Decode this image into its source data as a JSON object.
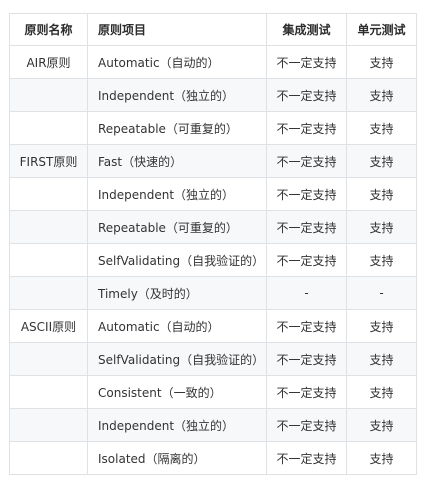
{
  "table": {
    "headers": {
      "principle": "原则名称",
      "item": "原则项目",
      "integration": "集成测试",
      "unit": "单元测试"
    },
    "rows": [
      {
        "principle": "AIR原则",
        "item": "Automatic（自动的）",
        "integration": "不一定支持",
        "unit": "支持"
      },
      {
        "principle": "",
        "item": "Independent（独立的）",
        "integration": "不一定支持",
        "unit": "支持"
      },
      {
        "principle": "",
        "item": "Repeatable（可重复的）",
        "integration": "不一定支持",
        "unit": "支持"
      },
      {
        "principle": "FIRST原则",
        "item": "Fast（快速的）",
        "integration": "不一定支持",
        "unit": "支持"
      },
      {
        "principle": "",
        "item": "Independent（独立的）",
        "integration": "不一定支持",
        "unit": "支持"
      },
      {
        "principle": "",
        "item": "Repeatable（可重复的）",
        "integration": "不一定支持",
        "unit": "支持"
      },
      {
        "principle": "",
        "item": "SelfValidating（自我验证的）",
        "integration": "不一定支持",
        "unit": "支持"
      },
      {
        "principle": "",
        "item": "Timely（及时的）",
        "integration": "-",
        "unit": "-"
      },
      {
        "principle": "ASCII原则",
        "item": "Automatic（自动的）",
        "integration": "不一定支持",
        "unit": "支持"
      },
      {
        "principle": "",
        "item": "SelfValidating（自我验证的）",
        "integration": "不一定支持",
        "unit": "支持"
      },
      {
        "principle": "",
        "item": "Consistent（一致的）",
        "integration": "不一定支持",
        "unit": "支持"
      },
      {
        "principle": "",
        "item": "Independent（独立的）",
        "integration": "不一定支持",
        "unit": "支持"
      },
      {
        "principle": "",
        "item": "Isolated（隔离的）",
        "integration": "不一定支持",
        "unit": "支持"
      }
    ]
  }
}
